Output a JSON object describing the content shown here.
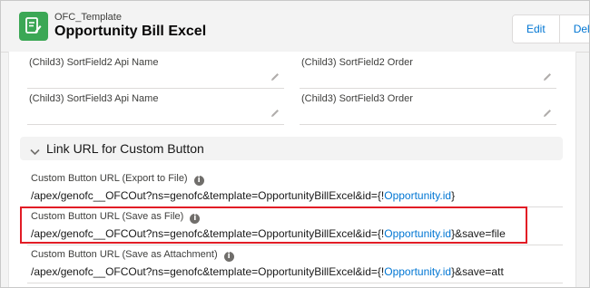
{
  "header": {
    "object_type": "OFC_Template",
    "record_title": "Opportunity Bill Excel",
    "edit_label": "Edit",
    "delete_label": "Delet"
  },
  "fields": [
    {
      "label": "(Child3) SortField2 Api Name"
    },
    {
      "label": "(Child3) SortField2 Order"
    },
    {
      "label": "(Child3) SortField3 Api Name"
    },
    {
      "label": "(Child3) SortField3 Order"
    }
  ],
  "section": {
    "title": "Link URL for Custom Button",
    "urls": [
      {
        "label": "Custom Button URL (Export to File)",
        "prefix": "/apex/genofc__OFCOut?ns=genofc&template=OpportunityBillExcel&id={!",
        "link": "Opportunity.id",
        "suffix": "}"
      },
      {
        "label": "Custom Button URL (Save as File)",
        "prefix": "/apex/genofc__OFCOut?ns=genofc&template=OpportunityBillExcel&id={!",
        "link": "Opportunity.id",
        "suffix": "}&save=file"
      },
      {
        "label": "Custom Button URL (Save as Attachment)",
        "prefix": "/apex/genofc__OFCOut?ns=genofc&template=OpportunityBillExcel&id={!",
        "link": "Opportunity.id",
        "suffix": "}&save=att"
      }
    ]
  },
  "colors": {
    "app_icon": "#3ba755",
    "link": "#0176d3",
    "highlight": "#e21c25"
  }
}
